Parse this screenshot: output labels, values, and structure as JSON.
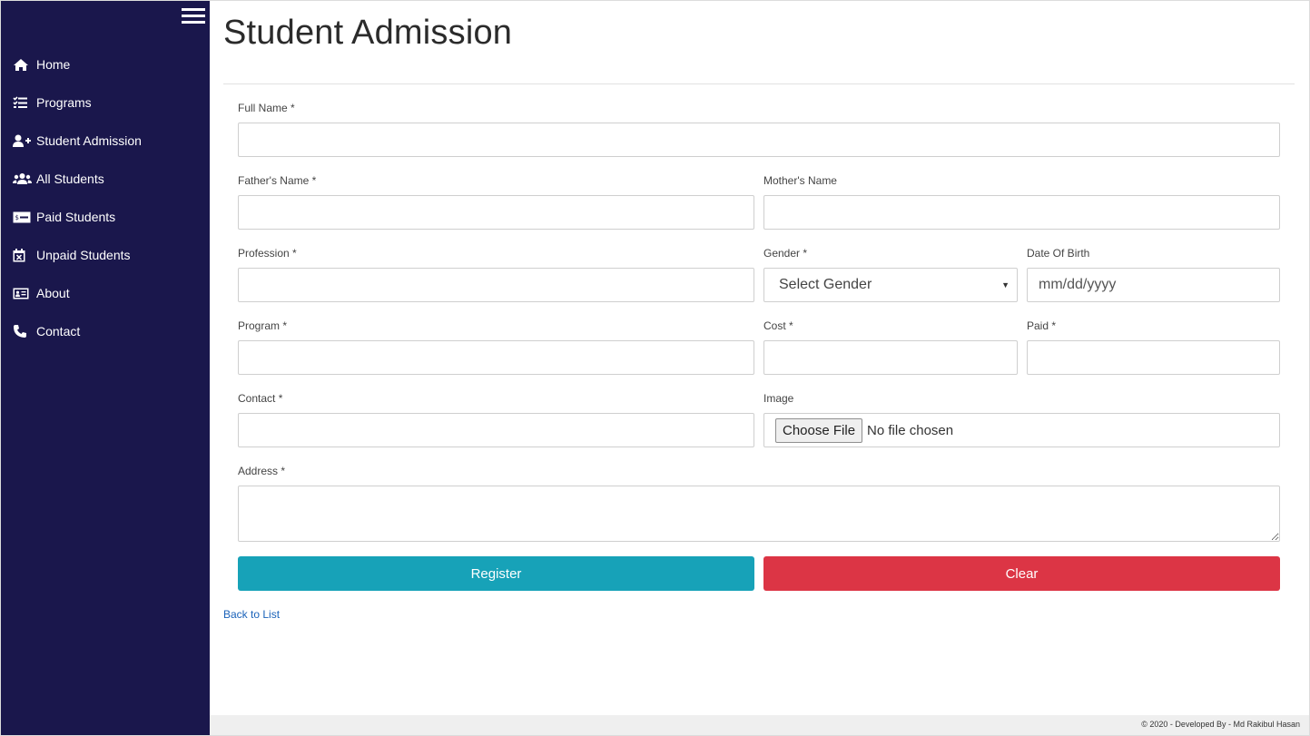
{
  "sidebar": {
    "items": [
      {
        "label": "Home",
        "icon": "home-icon"
      },
      {
        "label": "Programs",
        "icon": "tasks-icon"
      },
      {
        "label": "Student Admission",
        "icon": "user-plus-icon"
      },
      {
        "label": "All Students",
        "icon": "users-icon"
      },
      {
        "label": "Paid Students",
        "icon": "money-icon"
      },
      {
        "label": "Unpaid Students",
        "icon": "calendar-x-icon"
      },
      {
        "label": "About",
        "icon": "id-card-icon"
      },
      {
        "label": "Contact",
        "icon": "phone-icon"
      }
    ],
    "background": "#1a174c"
  },
  "page": {
    "title": "Student Admission"
  },
  "form": {
    "full_name": {
      "label": "Full Name  *",
      "value": ""
    },
    "fathers_name": {
      "label": "Father's Name *",
      "value": ""
    },
    "mothers_name": {
      "label": "Mother's Name",
      "value": ""
    },
    "profession": {
      "label": "Profession *",
      "value": ""
    },
    "gender": {
      "label": "Gender *",
      "selected": "Select Gender"
    },
    "date_of_birth": {
      "label": "Date Of Birth",
      "placeholder": "mm/dd/yyyy"
    },
    "program": {
      "label": "Program *",
      "value": ""
    },
    "cost": {
      "label": "Cost *",
      "value": ""
    },
    "paid": {
      "label": "Paid *",
      "value": ""
    },
    "contact": {
      "label": "Contact *",
      "value": ""
    },
    "image": {
      "label": "Image",
      "button": "Choose File",
      "status": "No file chosen"
    },
    "address": {
      "label": "Address *",
      "value": ""
    },
    "register_label": "Register",
    "clear_label": "Clear"
  },
  "links": {
    "back_to_list": "Back to List"
  },
  "footer": {
    "text": "© 2020 - Developed By - Md Rakibul Hasan"
  },
  "colors": {
    "register": "#17a2b8",
    "clear": "#dc3545",
    "link": "#1a62b9"
  }
}
